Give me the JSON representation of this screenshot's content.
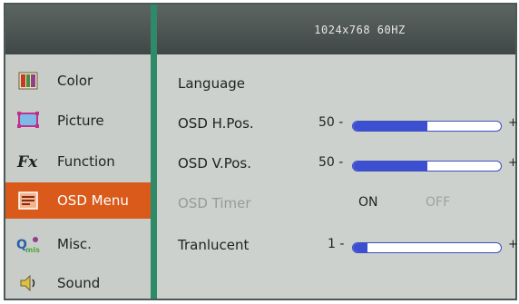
{
  "header": {
    "resolution": "1024x768  60HZ"
  },
  "sidebar": {
    "items": [
      {
        "label": "Color",
        "icon": "color-bars-icon"
      },
      {
        "label": "Picture",
        "icon": "monitor-icon"
      },
      {
        "label": "Function",
        "icon": "fx-icon"
      },
      {
        "label": "OSD Menu",
        "icon": "osd-menu-icon"
      },
      {
        "label": "Misc.",
        "icon": "misc-icon"
      },
      {
        "label": "Sound",
        "icon": "speaker-icon"
      }
    ],
    "selected": "OSD Menu",
    "selected_color": "#d95a1b"
  },
  "settings": {
    "language": {
      "label": "Language"
    },
    "h_pos": {
      "label": "OSD H.Pos.",
      "value": "50",
      "level": 0.5
    },
    "v_pos": {
      "label": "OSD V.Pos.",
      "value": "50",
      "level": 0.5
    },
    "timer": {
      "label": "OSD Timer",
      "on": "ON",
      "off": "OFF",
      "selected": "ON"
    },
    "translucent": {
      "label": "Tranlucent",
      "value": "1",
      "level": 0.1
    }
  },
  "colors": {
    "header_bg": "#4a5351",
    "panel_bg": "#cfd3cf",
    "divider": "#2e8a68",
    "slider_fill": "#3c4fd0"
  }
}
